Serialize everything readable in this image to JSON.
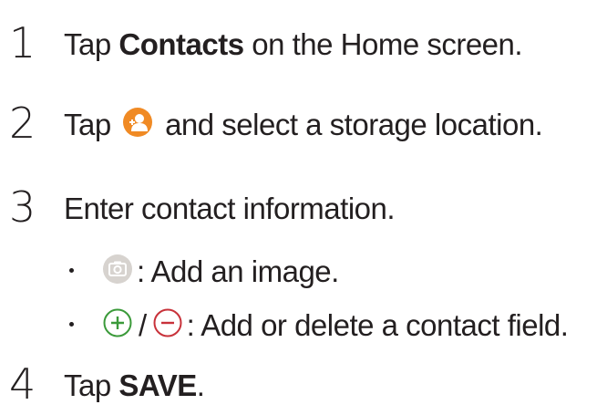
{
  "steps": [
    {
      "number": "1",
      "prefix": "Tap ",
      "bold": "Contacts",
      "suffix": " on the Home screen."
    },
    {
      "number": "2",
      "prefix": "Tap",
      "icon": "add-contact-icon",
      "suffix": "and select a storage location."
    },
    {
      "number": "3",
      "text": "Enter contact information.",
      "bullets": [
        {
          "icon": "camera-icon",
          "text": ": Add an image."
        },
        {
          "icons": [
            "plus-circle-icon",
            "minus-circle-icon"
          ],
          "separator": "/",
          "text": ": Add or delete a contact field."
        }
      ]
    },
    {
      "number": "4",
      "prefix": "Tap ",
      "bold": "SAVE",
      "suffix": "."
    }
  ],
  "colors": {
    "text": "#231f20",
    "add_contact_icon": "#f08a24",
    "camera_icon_bg": "#d7d3cf",
    "plus_icon": "#3b9a3a",
    "minus_icon": "#c8323a"
  }
}
